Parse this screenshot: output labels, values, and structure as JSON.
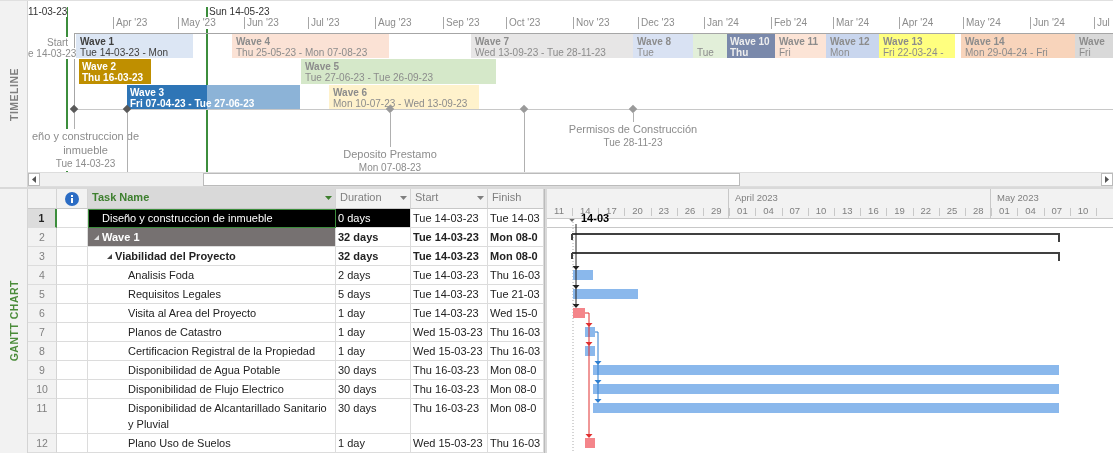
{
  "timeline": {
    "side_label": "TIMELINE",
    "range_start": "11-03-23",
    "today": "Sun 14-05-23",
    "start_caption": "Start",
    "start_date": "e 14-03-23",
    "months": [
      "Apr '23",
      "May '23",
      "Jun '23",
      "Jul '23",
      "Aug '23",
      "Sep '23",
      "Oct '23",
      "Nov '23",
      "Dec '23",
      "Jan '24",
      "Feb '24",
      "Mar '24",
      "Apr '24",
      "May '24",
      "Jun '24",
      "Jul"
    ],
    "bars": [
      {
        "name": "Wave 1",
        "dates": "Tue 14-03-23 - Mon",
        "color": "#dce6f4",
        "faded": false
      },
      {
        "name": "Wave 4",
        "dates": "Thu 25-05-23 - Mon 07-08-23",
        "color": "#fbe2d5",
        "faded": true
      },
      {
        "name": "Wave 7",
        "dates": "Wed 13-09-23 - Tue 28-11-23",
        "color": "#e7e6e6",
        "faded": true
      },
      {
        "name": "Wave 8",
        "dates": "Tue",
        "color": "#d9e2f3",
        "faded": true
      },
      {
        "dates": "Tue",
        "color": "#e2efd9",
        "faded": true
      },
      {
        "name": "Wave 10",
        "dates": "Thu",
        "color": "#7a89ab",
        "faded": true
      },
      {
        "name": "Wave 11",
        "dates": "Fri",
        "color": "#fce4d6",
        "faded": true
      },
      {
        "name": "Wave 12",
        "dates": "Mon",
        "color": "#c9d6ee",
        "faded": true
      },
      {
        "name": "Wave 13",
        "dates": "Fri 22-03-24 -",
        "color": "#ffff7f",
        "faded": true
      },
      {
        "name": "Wave 14",
        "dates": "Mon 29-04-24 - Fri",
        "color": "#f8d4bb",
        "faded": true
      },
      {
        "name": "Wave",
        "dates": "Fri",
        "color": "#d9d9d9",
        "faded": true
      },
      {
        "name": "Wave 2",
        "dates": "Thu 16-03-23",
        "color": "#bf8f00",
        "faded": false
      },
      {
        "name": "Wave 5",
        "dates": "Tue 27-06-23 - Tue 26-09-23",
        "color": "#d5e8c9",
        "faded": true
      },
      {
        "name": "Wave 3",
        "dates": "Fri 07-04-23 - Tue 27-06-23",
        "color": "#2e75b6",
        "faded": false,
        "level": 0.46
      },
      {
        "name": "Wave 6",
        "dates": "Mon 10-07-23 - Wed 13-09-23",
        "color": "#fff2cc",
        "faded": true
      }
    ],
    "milestones": [
      {
        "kind": "labeled",
        "name": "eño y construccion de inmueble",
        "date": "Tue 14-03-23"
      },
      {
        "kind": "marker"
      },
      {
        "kind": "labeled",
        "name": "Deposito Prestamo",
        "date": "Mon 07-08-23"
      },
      {
        "kind": "marker"
      },
      {
        "kind": "labeled",
        "name": "Permisos de Construcción",
        "date": "Tue 28-11-23"
      }
    ]
  },
  "gantt": {
    "side_label": "GANTT CHART",
    "columns": [
      {
        "kind": "info"
      },
      {
        "kind": "text",
        "label": "Task Name",
        "selected": true,
        "menu": true
      },
      {
        "kind": "text",
        "label": "Duration",
        "selected": false,
        "menu": true
      },
      {
        "kind": "text",
        "label": "Start",
        "selected": false,
        "menu": true
      },
      {
        "kind": "text",
        "label": "Finish",
        "selected": false,
        "menu": false
      }
    ],
    "timescale": {
      "months": [
        "April 2023",
        "May 2023"
      ],
      "days": [
        "11",
        "14",
        "17",
        "20",
        "23",
        "26",
        "29",
        "01",
        "04",
        "07",
        "10",
        "13",
        "16",
        "19",
        "22",
        "25",
        "28",
        "01",
        "04",
        "07",
        "10"
      ]
    },
    "tasks": [
      {
        "row": "1",
        "name": "Diseño y construccion de inmueble",
        "duration": "0 days",
        "start": "Tue 14-03-23",
        "finish": "Tue 14-03",
        "kind": "milestone",
        "selected": true,
        "bar_label": "14-03"
      },
      {
        "row": "2",
        "name": "Wave 1",
        "duration": "32 days",
        "start": "Tue 14-03-23",
        "finish": "Mon 08-0",
        "kind": "phase",
        "selected": false,
        "expanded": true,
        "children": [
          {
            "row": "3",
            "name": "Viabilidad del Proyecto",
            "duration": "32 days",
            "start": "Tue 14-03-23",
            "finish": "Mon 08-0",
            "kind": "summary",
            "selected": false,
            "expanded": true,
            "children": [
              {
                "row": "4",
                "name": "Analisis Foda",
                "duration": "2 days",
                "start": "Tue 14-03-23",
                "finish": "Thu 16-03",
                "kind": "task",
                "selected": false,
                "critical": false
              },
              {
                "row": "5",
                "name": "Requisitos Legales",
                "duration": "5 days",
                "start": "Tue 14-03-23",
                "finish": "Tue 21-03",
                "kind": "task",
                "selected": false,
                "critical": false
              },
              {
                "row": "6",
                "name": "Visita al Area del Proyecto",
                "duration": "1 day",
                "start": "Tue 14-03-23",
                "finish": "Wed 15-0",
                "kind": "task",
                "selected": false,
                "critical": true
              },
              {
                "row": "7",
                "name": "Planos de Catastro",
                "duration": "1 day",
                "start": "Wed 15-03-23",
                "finish": "Thu 16-03",
                "kind": "task",
                "selected": false,
                "critical": false
              },
              {
                "row": "8",
                "name": "Certificacion Registral de la Propiedad",
                "duration": "1 day",
                "start": "Wed 15-03-23",
                "finish": "Thu 16-03",
                "kind": "task",
                "selected": false,
                "critical": false
              },
              {
                "row": "9",
                "name": "Disponibilidad de Agua Potable",
                "duration": "30 days",
                "start": "Thu 16-03-23",
                "finish": "Mon 08-0",
                "kind": "task",
                "selected": false,
                "critical": false
              },
              {
                "row": "10",
                "name": "Disponibilidad de Flujo Electrico",
                "duration": "30 days",
                "start": "Thu 16-03-23",
                "finish": "Mon 08-0",
                "kind": "task",
                "selected": false,
                "critical": false
              },
              {
                "row": "11",
                "name": "Disponibilidad de Alcantarillado Sanitario y Pluvial",
                "duration": "30 days",
                "start": "Thu 16-03-23",
                "finish": "Mon 08-0",
                "kind": "task",
                "selected": false,
                "critical": false
              },
              {
                "row": "12",
                "name": "Plano Uso de Suelos",
                "duration": "1 day",
                "start": "Wed 15-03-23",
                "finish": "Thu 16-03",
                "kind": "task",
                "selected": false,
                "critical": true
              }
            ]
          }
        ]
      }
    ]
  }
}
